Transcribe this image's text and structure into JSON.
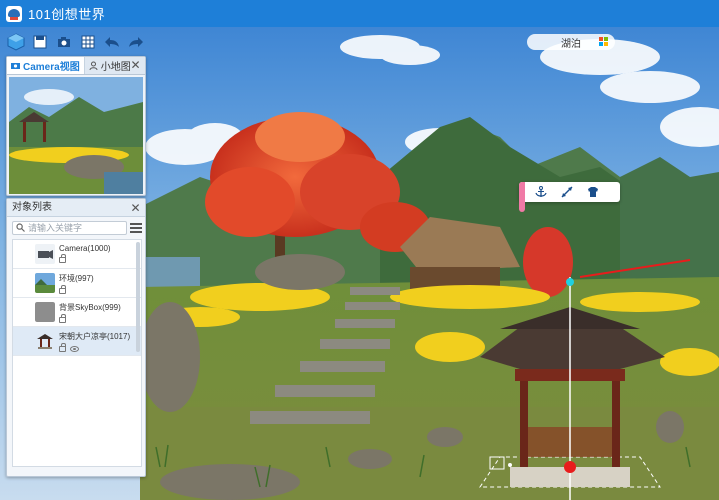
{
  "app": {
    "title": "101创想世界"
  },
  "toolbar": {
    "buttons": [
      {
        "name": "logo-cube",
        "icon": "cube-icon"
      },
      {
        "name": "save",
        "icon": "save-icon"
      },
      {
        "name": "screenshot",
        "icon": "camera-icon"
      },
      {
        "name": "grid",
        "icon": "grid-icon"
      },
      {
        "name": "undo",
        "icon": "undo-icon"
      },
      {
        "name": "redo",
        "icon": "redo-icon"
      }
    ]
  },
  "weather": {
    "label": "湖泊"
  },
  "camera_panel": {
    "tabs": [
      {
        "label": "Camera视图",
        "active": true
      },
      {
        "label": "小地图",
        "active": false
      }
    ]
  },
  "object_panel": {
    "title": "对象列表",
    "search_placeholder": "请输入关键字",
    "items": [
      {
        "name": "Camera(1000)",
        "thumb": "camera",
        "locked": true,
        "visible": false,
        "selected": false
      },
      {
        "name": "环境(997)",
        "thumb": "environment",
        "locked": true,
        "visible": false,
        "selected": false
      },
      {
        "name": "背景SkyBox(999)",
        "thumb": "skybox",
        "locked": true,
        "visible": false,
        "selected": false
      },
      {
        "name": "宋朝大户凉亭(1017)",
        "thumb": "pavilion",
        "locked": true,
        "visible": true,
        "selected": true
      }
    ]
  },
  "context_bar": {
    "buttons": [
      {
        "name": "anchor",
        "icon": "anchor-icon"
      },
      {
        "name": "scale",
        "icon": "arrows-icon"
      },
      {
        "name": "texture",
        "icon": "shirt-icon"
      }
    ]
  },
  "colors": {
    "titlebar": "#1e7fd8",
    "accent": "#1e7fd8",
    "highlight": "#f07aa6"
  }
}
